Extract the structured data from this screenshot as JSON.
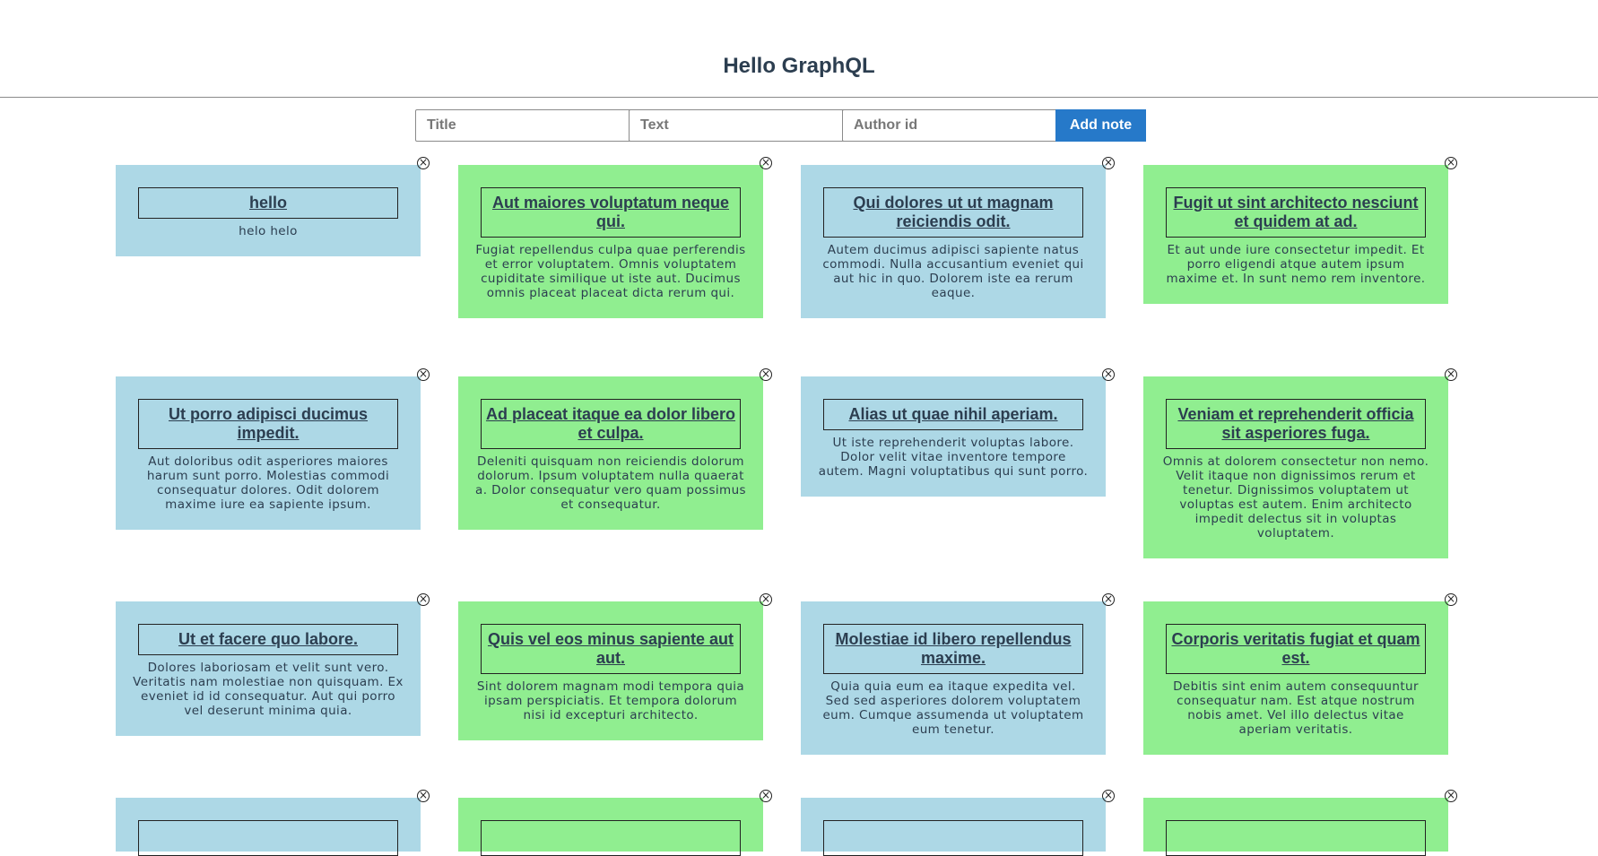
{
  "app": {
    "title": "Hello GraphQL"
  },
  "form": {
    "title_placeholder": "Title",
    "text_placeholder": "Text",
    "author_placeholder": "Author id",
    "add_label": "Add note"
  },
  "colors": {
    "blue_card": "#add8e6",
    "green_card": "#90ee90",
    "button": "#2679c9"
  },
  "notes": [
    {
      "title": "hello",
      "text": "helo helo",
      "color": "blue"
    },
    {
      "title": "Aut maiores voluptatum neque qui.",
      "text": "Fugiat repellendus culpa quae perferendis et error voluptatem. Omnis voluptatem cupiditate similique ut iste aut. Ducimus omnis placeat placeat dicta rerum qui.",
      "color": "green"
    },
    {
      "title": "Qui dolores ut ut magnam reiciendis odit.",
      "text": "Autem ducimus adipisci sapiente natus commodi. Nulla accusantium eveniet qui aut hic in quo. Dolorem iste ea rerum eaque.",
      "color": "blue"
    },
    {
      "title": "Fugit ut sint architecto nesciunt et quidem at ad.",
      "text": "Et aut unde iure consectetur impedit. Et porro eligendi atque autem ipsum maxime et. In sunt nemo rem inventore.",
      "color": "green"
    },
    {
      "title": "Ut porro adipisci ducimus impedit.",
      "text": "Aut doloribus odit asperiores maiores harum sunt porro. Molestias commodi consequatur dolores. Odit dolorem maxime iure ea sapiente ipsum.",
      "color": "blue"
    },
    {
      "title": "Ad placeat itaque ea dolor libero et culpa.",
      "text": "Deleniti quisquam non reiciendis dolorum dolorum. Ipsum voluptatem nulla quaerat a. Dolor consequatur vero quam possimus et consequatur.",
      "color": "green"
    },
    {
      "title": "Alias ut quae nihil aperiam.",
      "text": "Ut iste reprehenderit voluptas labore. Dolor velit vitae inventore tempore autem. Magni voluptatibus qui sunt porro.",
      "color": "blue"
    },
    {
      "title": "Veniam et reprehenderit officia sit asperiores fuga.",
      "text": "Omnis at dolorem consectetur non nemo. Velit itaque non dignissimos rerum et tenetur. Dignissimos voluptatem ut voluptas est autem. Enim architecto impedit delectus sit in voluptas voluptatem.",
      "color": "green"
    },
    {
      "title": "Ut et facere quo labore.",
      "text": "Dolores laboriosam et velit sunt vero. Veritatis nam molestiae non quisquam. Ex eveniet id id consequatur. Aut qui porro vel deserunt minima quia.",
      "color": "blue"
    },
    {
      "title": "Quis vel eos minus sapiente aut aut.",
      "text": "Sint dolorem magnam modi tempora quia ipsam perspiciatis. Et tempora dolorum nisi id excepturi architecto.",
      "color": "green"
    },
    {
      "title": "Molestiae id libero repellendus maxime.",
      "text": "Quia quia eum ea itaque expedita vel. Sed sed asperiores dolorem voluptatem eum. Cumque assumenda ut voluptatem eum tenetur.",
      "color": "blue"
    },
    {
      "title": "Corporis veritatis fugiat et quam est.",
      "text": "Debitis sint enim autem consequuntur consequatur nam. Est atque nostrum nobis amet. Vel illo delectus vitae aperiam veritatis.",
      "color": "green"
    }
  ]
}
